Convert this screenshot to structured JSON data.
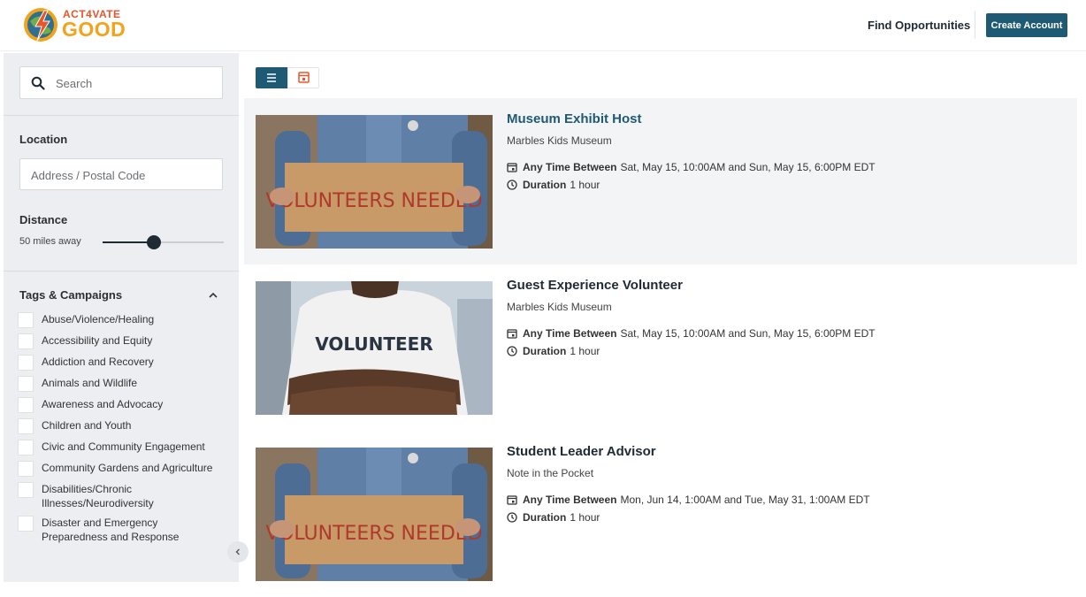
{
  "header": {
    "logo_line1": "ACT4VATE",
    "logo_line2": "GOOD",
    "find_label": "Find Opportunities",
    "create_label": "Create Account",
    "colors": {
      "primary": "#1e5a74",
      "logo_orange": "#e8562c",
      "logo_yellow": "#f2a31b"
    }
  },
  "view_toggle": {
    "active": "list",
    "icons": [
      "list-icon",
      "calendar-icon"
    ]
  },
  "sidebar": {
    "search_placeholder": "Search",
    "location_label": "Location",
    "address_placeholder": "Address / Postal Code",
    "distance_label": "Distance",
    "distance_value": "50 miles away",
    "distance_slider_fraction": 0.42,
    "tags_label": "Tags & Campaigns",
    "tags": [
      "Abuse/Violence/Healing",
      "Accessibility and Equity",
      "Addiction and Recovery",
      "Animals and Wildlife",
      "Awareness and Advocacy",
      "Children and Youth",
      "Civic and Community Engagement",
      "Community Gardens and Agriculture",
      "Disabilities/Chronic Illnesses/Neurodiversity",
      "Disaster and Emergency Preparedness and Response"
    ],
    "collapse_icon": "chevron-left-icon"
  },
  "opportunities": [
    {
      "title": "Museum Exhibit Host",
      "title_color": "#1e5a74",
      "org": "Marbles Kids Museum",
      "time_label": "Any Time Between",
      "time_value": "Sat, May 15, 10:00AM and Sun, May 15, 6:00PM EDT",
      "duration_label": "Duration",
      "duration_value": "1 hour",
      "sign_text": "VOLUNTEERS NEEDED"
    },
    {
      "title": "Guest Experience Volunteer",
      "title_color": "#1f2a33",
      "org": "Marbles Kids Museum",
      "time_label": "Any Time Between",
      "time_value": "Sat, May 15, 10:00AM and Sun, May 15, 6:00PM EDT",
      "duration_label": "Duration",
      "duration_value": "1 hour",
      "sign_text": "VOLUNTEER"
    },
    {
      "title": "Student Leader Advisor",
      "title_color": "#1f2a33",
      "org": "Note in the Pocket",
      "time_label": "Any Time Between",
      "time_value": "Mon, Jun 14, 1:00AM and Tue, May 31, 1:00AM EDT",
      "duration_label": "Duration",
      "duration_value": "1 hour",
      "sign_text": "VOLUNTEERS NEEDED"
    }
  ]
}
